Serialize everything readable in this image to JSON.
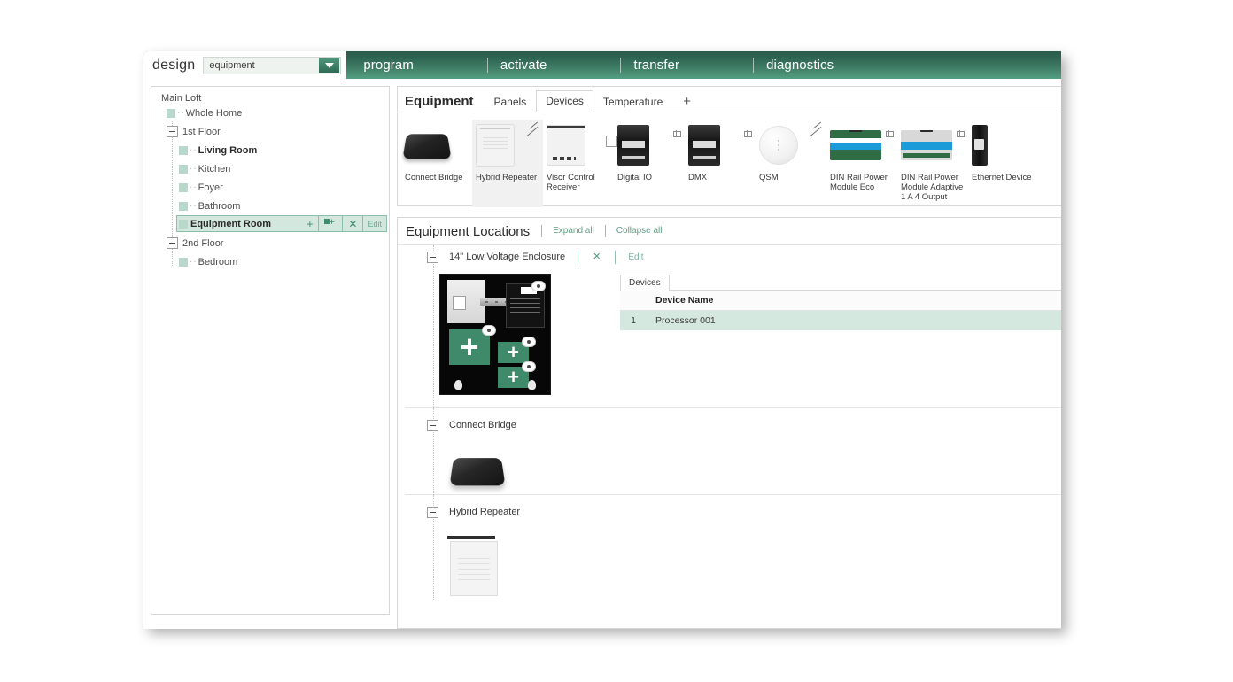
{
  "app": {
    "title": "design",
    "mode_select": {
      "value": "equipment",
      "arrow_icon": "chevron-down-icon"
    },
    "nav": [
      {
        "label": "program"
      },
      {
        "label": "activate"
      },
      {
        "label": "transfer"
      },
      {
        "label": "diagnostics"
      }
    ]
  },
  "tree": {
    "root": "Main Loft",
    "items": [
      {
        "label": "Whole Home",
        "level": 1,
        "type": "leaf"
      },
      {
        "label": "1st Floor",
        "level": 1,
        "type": "expanded"
      },
      {
        "label": "Living Room",
        "level": 2,
        "type": "leaf",
        "bold": true
      },
      {
        "label": "Kitchen",
        "level": 2,
        "type": "leaf"
      },
      {
        "label": "Foyer",
        "level": 2,
        "type": "leaf"
      },
      {
        "label": "Bathroom",
        "level": 2,
        "type": "leaf"
      },
      {
        "label": "Equipment Room",
        "level": 2,
        "type": "leaf",
        "selected": true
      },
      {
        "label": "2nd Floor",
        "level": 1,
        "type": "expanded"
      },
      {
        "label": "Bedroom",
        "level": 2,
        "type": "leaf"
      }
    ],
    "selected_actions": {
      "add": "+",
      "add_area_icon": "add-area-icon",
      "delete": "✕",
      "edit": "Edit"
    }
  },
  "equipment": {
    "title": "Equipment",
    "tabs": [
      {
        "label": "Panels",
        "active": false
      },
      {
        "label": "Devices",
        "active": true
      },
      {
        "label": "Temperature",
        "active": false
      }
    ],
    "add_tab": "+",
    "devices": [
      {
        "name": "Connect Bridge",
        "icon": "connect-bridge-thumb",
        "selected": false
      },
      {
        "name": "Hybrid Repeater",
        "icon": "hybrid-repeater-thumb",
        "selected": true
      },
      {
        "name": "Visor Control Receiver",
        "icon": "visor-control-receiver-thumb",
        "selected": false
      },
      {
        "name": "Digital IO",
        "icon": "digital-io-thumb",
        "selected": false
      },
      {
        "name": "DMX",
        "icon": "dmx-thumb",
        "selected": false
      },
      {
        "name": "QSM",
        "icon": "qsm-thumb",
        "selected": false
      },
      {
        "name": "DIN Rail Power Module Eco",
        "icon": "din-rail-power-module-eco-thumb",
        "selected": false
      },
      {
        "name": "DIN Rail Power Module Adaptive 1 A 4 Output",
        "icon": "din-rail-power-module-adaptive-thumb",
        "selected": false
      },
      {
        "name": "Ethernet Device",
        "icon": "ethernet-device-thumb",
        "selected": false
      }
    ]
  },
  "locations": {
    "title": "Equipment Locations",
    "expand_all": "Expand all",
    "collapse_all": "Collapse all",
    "sections": [
      {
        "name": "14\" Low Voltage Enclosure",
        "actions": {
          "delete": "✕",
          "edit": "Edit"
        },
        "devices_tab": "Devices",
        "table": {
          "columns": [
            "",
            "Device Name"
          ],
          "rows": [
            {
              "index": "1",
              "device_name": "Processor 001",
              "selected": true
            }
          ]
        }
      },
      {
        "name": "Connect Bridge",
        "actions": {},
        "thumb": "connect-bridge-thumb"
      },
      {
        "name": "Hybrid Repeater",
        "actions": {},
        "thumb": "hybrid-repeater-thumb"
      }
    ]
  },
  "colors": {
    "brand_green_dark": "#2c5b4b",
    "brand_green_light": "#53a081",
    "accent_green": "#3f8d70",
    "selection_green": "#d3e7de",
    "tile_green": "#3f8a6b"
  }
}
